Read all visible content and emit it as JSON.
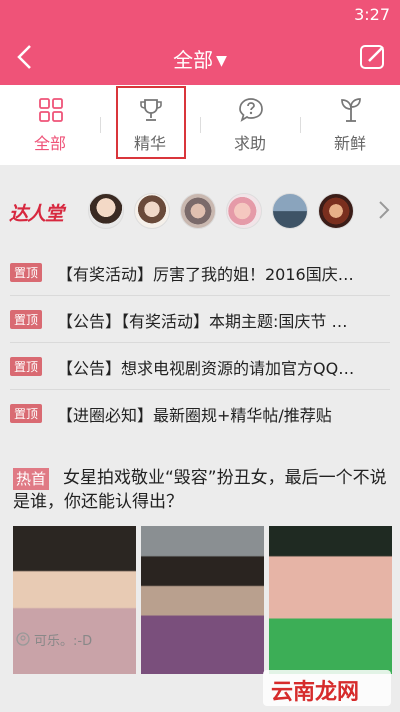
{
  "status": {
    "time": "3:27"
  },
  "header": {
    "title": "全部",
    "caret": "▼",
    "back_icon": "chevron-left-icon",
    "edit_icon": "edit-icon"
  },
  "tabs": [
    {
      "label": "全部",
      "icon": "grid-icon",
      "active": true
    },
    {
      "label": "精华",
      "icon": "trophy-icon",
      "active": false
    },
    {
      "label": "求助",
      "icon": "question-bubble-icon",
      "active": false
    },
    {
      "label": "新鲜",
      "icon": "sprout-icon",
      "active": false
    }
  ],
  "talent": {
    "logo": "达人堂",
    "arrow_icon": "chevron-right-icon"
  },
  "pinned": [
    {
      "tag": "置顶",
      "text": "【有奖活动】厉害了我的姐！2016国庆…"
    },
    {
      "tag": "置顶",
      "text": "【公告】【有奖活动】本期主题:国庆节 …"
    },
    {
      "tag": "置顶",
      "text": "【公告】想求电视剧资源的请加官方QQ…"
    },
    {
      "tag": "置顶",
      "text": "【进圈必知】最新圈规+精华帖/推荐贴"
    }
  ],
  "post": {
    "tag": "热首",
    "title": "女星拍戏敬业“毁容”扮丑女，最后一个不说是谁，你还能认得出？",
    "author": "可乐。:-D"
  },
  "watermark": {
    "text": "云南龙网"
  },
  "colors": {
    "brand": "#ef5378",
    "tag": "#d96a72",
    "highlight": "#d9353b"
  }
}
